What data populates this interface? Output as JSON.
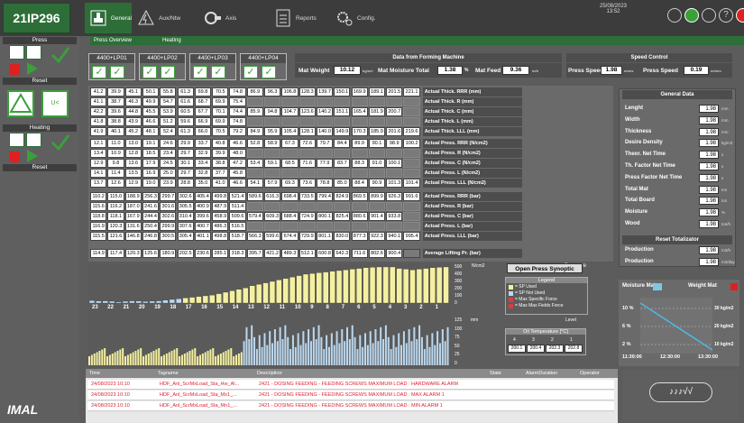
{
  "header": {
    "plant_id": "21IP296",
    "date": "25/08/2023",
    "time": "13:52",
    "tabs": [
      {
        "label": "General"
      },
      {
        "label": "Aux/Ntw"
      },
      {
        "label": "Axis"
      },
      {
        "label": "Reports"
      },
      {
        "label": "Config."
      }
    ],
    "subtabs": [
      "Press Overview",
      "Heating"
    ]
  },
  "left": {
    "press": "Press",
    "reset": "Reset",
    "heating": "Heating",
    "reset2": "Reset",
    "u_label": "U<"
  },
  "lp": [
    "4400+LP01",
    "4400+LP02",
    "4400+LP03",
    "4400+LP04"
  ],
  "forming": {
    "title": "Data from Forming Machine",
    "mat_weight_label": "Mat Weight",
    "mat_weight": "10.12",
    "mat_weight_unit": "kg/m2",
    "moisture_label": "Mat Moisture Total",
    "moisture": "1.38",
    "moisture_unit": "%",
    "feed_label": "Mat Feed",
    "feed": "9.36",
    "feed_unit": "m/h"
  },
  "speed": {
    "title": "Speed Control",
    "ps1_label": "Press Speed",
    "ps1": "1.98",
    "ps1_unit": "mm/s",
    "ps2_label": "Press Speed",
    "ps2": "0.19",
    "ps2_unit": "m/min"
  },
  "thick_rows": [
    {
      "label": "Actual Thick. RRR (mm)",
      "v": [
        "41.2",
        "39.9",
        "45.1",
        "50.1",
        "55.8",
        "61.3",
        "69.8",
        "70.5",
        "74.8",
        "86.9",
        "96.3",
        "106.8",
        "128.3",
        "139.7",
        "150.1",
        "169.9",
        "189.1",
        "201.5",
        "221.1"
      ]
    },
    {
      "label": "Actual Thick. R (mm)",
      "v": [
        "41.1",
        "38.7",
        "46.3",
        "49.9",
        "54.7",
        "61.6",
        "68.7",
        "69.9",
        "75.4",
        "",
        "",
        "",
        "",
        "",
        "",
        "",
        "",
        "",
        ""
      ]
    },
    {
      "label": "Actual Thick. C (mm)",
      "v": [
        "42.2",
        "39.6",
        "44.8",
        "45.5",
        "53.9",
        "60.5",
        "67.7",
        "70.1",
        "74.4",
        "85.9",
        "94.8",
        "104.7",
        "123.6",
        "140.2",
        "151.1",
        "165.4",
        "181.9",
        "200.7",
        ""
      ]
    },
    {
      "label": "Actual Thick. L (mm)",
      "v": [
        "41.8",
        "38.8",
        "43.9",
        "46.6",
        "51.2",
        "59.6",
        "66.9",
        "69.9",
        "74.8",
        "",
        "",
        "",
        "",
        "",
        "",
        "",
        "",
        "",
        ""
      ]
    },
    {
      "label": "Actual Thick. LLL (mm)",
      "v": [
        "41.9",
        "40.1",
        "45.2",
        "48.1",
        "52.4",
        "61.3",
        "66.0",
        "70.5",
        "79.2",
        "84.9",
        "95.9",
        "105.4",
        "128.1",
        "140.0",
        "149.9",
        "170.3",
        "185.9",
        "201.6",
        "219.6"
      ]
    }
  ],
  "pressn_rows": [
    {
      "label": "Actual Press. RRR (N/cm2)",
      "v": [
        "12.1",
        "11.0",
        "13.0",
        "19.1",
        "24.6",
        "29.9",
        "33.7",
        "40.8",
        "46.6",
        "52.8",
        "58.9",
        "67.3",
        "72.6",
        "79.7",
        "84.4",
        "89.9",
        "90.1",
        "98.9",
        "100.2"
      ]
    },
    {
      "label": "Actual Press. R (N/cm2)",
      "v": [
        "13.4",
        "10.9",
        "12.8",
        "18.5",
        "23.4",
        "29.7",
        "32.9",
        "39.9",
        "48.0",
        "",
        "",
        "",
        "",
        "",
        "",
        "",
        "",
        "",
        ""
      ]
    },
    {
      "label": "Actual Press. C (N/cm2)",
      "v": [
        "12.9",
        "9.8",
        "13.6",
        "17.9",
        "24.5",
        "30.1",
        "33.4",
        "38.8",
        "47.2",
        "53.4",
        "59.1",
        "68.5",
        "71.6",
        "77.9",
        "83.7",
        "88.3",
        "91.0",
        "100.1",
        ""
      ]
    },
    {
      "label": "Actual Press. L (N/cm2)",
      "v": [
        "14.1",
        "11.4",
        "13.5",
        "16.9",
        "25.0",
        "29.7",
        "32.8",
        "37.7",
        "45.8",
        "",
        "",
        "",
        "",
        "",
        "",
        "",
        "",
        "",
        ""
      ]
    },
    {
      "label": "Actual Press. LLL (N/cm2)",
      "v": [
        "13.7",
        "12.6",
        "12.9",
        "19.0",
        "23.9",
        "28.8",
        "35.0",
        "41.0",
        "46.6",
        "54.1",
        "57.9",
        "69.3",
        "73.6",
        "78.8",
        "85.0",
        "88.4",
        "90.9",
        "101.3",
        "101.4"
      ]
    }
  ],
  "pressbar_rows": [
    {
      "label": "Actual Press. RRR (bar)",
      "v": [
        "110.2",
        "115.0",
        "188.9",
        "256.3",
        "299.7",
        "302.6",
        "405.4",
        "499.8",
        "521.4",
        "589.6",
        "616.3",
        "698.4",
        "733.5",
        "799.4",
        "824.9",
        "869.5",
        "899.9",
        "926.3",
        "991.6"
      ]
    },
    {
      "label": "Actual Press. R (bar)",
      "v": [
        "115.6",
        "116.2",
        "187.0",
        "241.6",
        "301.6",
        "305.5",
        "400.9",
        "487.9",
        "511.4",
        "",
        "",
        "",
        "",
        "",
        "",
        "",
        "",
        "",
        ""
      ]
    },
    {
      "label": "Actual Press. C (bar)",
      "v": [
        "118.8",
        "118.1",
        "167.9",
        "244.4",
        "302.6",
        "310.4",
        "399.6",
        "458.9",
        "509.6",
        "579.4",
        "609.3",
        "688.4",
        "724.9",
        "800.1",
        "825.4",
        "880.6",
        "901.4",
        "933.8",
        ""
      ]
    },
    {
      "label": "Actual Press. L (bar)",
      "v": [
        "116.9",
        "120.3",
        "131.6",
        "250.4",
        "299.9",
        "307.6",
        "400.7",
        "486.3",
        "516.5",
        "",
        "",
        "",
        "",
        "",
        "",
        "",
        "",
        "",
        ""
      ]
    },
    {
      "label": "Actual Press. LLL (bar)",
      "v": [
        "115.5",
        "121.6",
        "146.8",
        "246.8",
        "300.5",
        "305.4",
        "401.1",
        "498.8",
        "518.7",
        "566.3",
        "599.6",
        "674.4",
        "729.9",
        "801.1",
        "830.0",
        "877.3",
        "922.3",
        "940.1",
        "995.4"
      ]
    }
  ],
  "lifting_row": {
    "label": "Average Lifting Pr. (bar)",
    "v": [
      "114.9",
      "117.4",
      "120.3",
      "125.6",
      "180.9",
      "202.5",
      "230.6",
      "285.1",
      "318.3",
      "395.7",
      "421.2",
      "489.3",
      "512.1",
      "600.8",
      "642.3",
      "711.6",
      "802.6",
      "900.4",
      ""
    ]
  },
  "general": {
    "title": "General Data",
    "rows": [
      {
        "label": "Lenght",
        "value": "1.98",
        "unit": "mm"
      },
      {
        "label": "Width",
        "value": "1.98",
        "unit": "mm"
      },
      {
        "label": "Thickness",
        "value": "1.98",
        "unit": "mm"
      },
      {
        "label": "Desire Density",
        "value": "1.98",
        "unit": "kg/m3"
      },
      {
        "label": "Theor. Net Time",
        "value": "1.98",
        "unit": "s"
      },
      {
        "label": "Th. Factor Net Time",
        "value": "1.98",
        "unit": "s"
      },
      {
        "label": "Press Factor Net Time",
        "value": "1.98",
        "unit": "s"
      },
      {
        "label": "Total Mat",
        "value": "1.98",
        "unit": "ton"
      },
      {
        "label": "Total Board",
        "value": "1.98",
        "unit": "ton"
      },
      {
        "label": "Moisture",
        "value": "1.98",
        "unit": "%"
      },
      {
        "label": "Wood",
        "value": "1.98",
        "unit": "ton/h"
      }
    ],
    "reset_title": "Reset Totalizator",
    "prod": [
      {
        "label": "Production",
        "value": "1.98",
        "unit": "m3/h"
      },
      {
        "label": "Production",
        "value": "1.98",
        "unit": "m3/day"
      }
    ]
  },
  "chart_top": {
    "ylabel": "N/cm2",
    "ylabel2": "Pressure",
    "ticks": [
      "500",
      "400",
      "300",
      "200",
      "100",
      "0"
    ],
    "values": [
      35,
      28,
      30,
      25,
      15,
      25,
      30,
      28,
      22,
      26,
      30,
      40,
      50,
      60,
      70,
      80,
      90,
      100,
      110,
      130,
      150,
      170,
      190,
      210,
      240,
      260,
      280,
      300,
      320,
      340,
      360,
      380,
      400,
      410,
      420,
      430,
      440,
      450,
      460,
      470,
      480,
      490,
      495,
      500,
      500,
      500,
      480,
      470,
      460,
      470,
      480,
      490,
      495,
      500
    ],
    "x_labels": [
      "23",
      "22",
      "21",
      "20",
      "19",
      "18",
      "17",
      "16",
      "15",
      "14",
      "13",
      "12",
      "11",
      "10",
      "9",
      "8",
      "7",
      "6",
      "5",
      "4",
      "3",
      "2",
      "1"
    ],
    "x_sub": "24 23 22 21|20 19|27 26|25 24|23 22|21 20|19 18|17 16|15 14|13 12|11 10|9 8|7 6|5 4|3 2|1"
  },
  "chart_bottom": {
    "ylabel": "mm",
    "ylabel2": "Level",
    "ticks": [
      "125",
      "100",
      "75",
      "50",
      "25",
      "0"
    ]
  },
  "open_synoptic": "Open Press Synoptic",
  "legend": {
    "title": "Legend",
    "items": [
      {
        "label": "= SP Used",
        "color": "#f4f0a0"
      },
      {
        "label": "= SP Not Used",
        "color": "#bcd8ef"
      },
      {
        "label": "= Max Specific Force",
        "color": "#e03a3a"
      },
      {
        "label": "= Max Max Fields Force",
        "color": "#e03a3a"
      }
    ]
  },
  "oil": {
    "title": "Oil Temperature [°C]",
    "heads": [
      "4",
      "3",
      "2",
      "1"
    ],
    "vals": [
      "200.1",
      "200.4",
      "202.3",
      "202.8"
    ]
  },
  "moisture_chart": {
    "title1": "Moisture Mat",
    "title2": "Weight Mat",
    "y_left": [
      "10 %",
      "6 %",
      "2 %"
    ],
    "y_right": [
      "30 kg/m2",
      "20 kg/m2",
      "10 kg/m2"
    ],
    "x": [
      "11:30:00",
      "12:30:00",
      "13:30:00"
    ]
  },
  "alarms": {
    "cols": [
      "Time",
      "Tagname",
      "Description",
      "State",
      "AlarmDuration",
      "Operator"
    ],
    "rows": [
      {
        "time": "24/08/2023 10:10",
        "tag": "HDF_Anl_ScrMxLoad_Sta_Hw_Al...",
        "desc": "2421 - DOSING FEEDING - FEEDING SCREWS MAXIMUM LOAD : HARDWARE ALARM"
      },
      {
        "time": "24/08/2023 10:10",
        "tag": "HDF_Anl_ScrMxLoad_Sta_Mx1_...",
        "desc": "2421 - DOSING FEEDING - FEEDING SCREWS MAXIMUM LOAD : MAX ALARM 1"
      },
      {
        "time": "24/08/2023 10:10",
        "tag": "HDF_Anl_ScrMxLoad_Sta_Mn1_...",
        "desc": "2421 - DOSING FEEDING - FEEDING SCREWS MAXIMUM LOAD : MIN ALARM 1"
      }
    ]
  },
  "logo": "IMAL"
}
